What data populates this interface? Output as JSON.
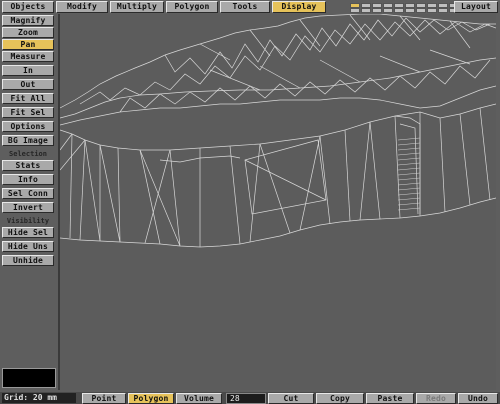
{
  "top_tabs": [
    {
      "label": "Objects",
      "selected": false
    },
    {
      "label": "Modify",
      "selected": false
    },
    {
      "label": "Multiply",
      "selected": false
    },
    {
      "label": "Polygon",
      "selected": false
    },
    {
      "label": "Tools",
      "selected": false
    },
    {
      "label": "Display",
      "selected": true
    }
  ],
  "layout_label": "Layout",
  "layer_buttons": {
    "count": 10,
    "active_index": 0
  },
  "sidebar": {
    "buttons": [
      {
        "label": "Magnify",
        "selected": false
      },
      {
        "label": "Zoom",
        "selected": false
      },
      {
        "label": "Pan",
        "selected": true
      },
      {
        "label": "Measure",
        "selected": false
      },
      {
        "label": "In",
        "selected": false
      },
      {
        "label": "Out",
        "selected": false
      },
      {
        "label": "Fit All",
        "selected": false
      },
      {
        "label": "Fit Sel",
        "selected": false
      },
      {
        "label": "Options",
        "selected": false
      },
      {
        "label": "BG Image",
        "selected": false
      }
    ],
    "selection_title": "Selection",
    "selection_buttons": [
      {
        "label": "Stats"
      },
      {
        "label": "Info"
      },
      {
        "label": "Sel Conn"
      },
      {
        "label": "Invert"
      }
    ],
    "visibility_title": "Visibility",
    "visibility_buttons": [
      {
        "label": "Hide Sel"
      },
      {
        "label": "Hide Uns"
      },
      {
        "label": "Unhide"
      }
    ]
  },
  "statusbar": {
    "grid_label": "Grid: 20 mm",
    "modes": [
      {
        "label": "Point",
        "selected": false
      },
      {
        "label": "Polygon",
        "selected": true
      },
      {
        "label": "Volume",
        "selected": false
      }
    ],
    "count_value": "28",
    "cut_label": "Cut",
    "copy_label": "Copy",
    "paste_label": "Paste",
    "redo_label": "Redo",
    "undo_label": "Undo"
  },
  "colors": {
    "accent": "#e6c25a",
    "button": "#a9a9a9",
    "viewport": "#5c5c5c",
    "wire": "#d8d8d8"
  }
}
